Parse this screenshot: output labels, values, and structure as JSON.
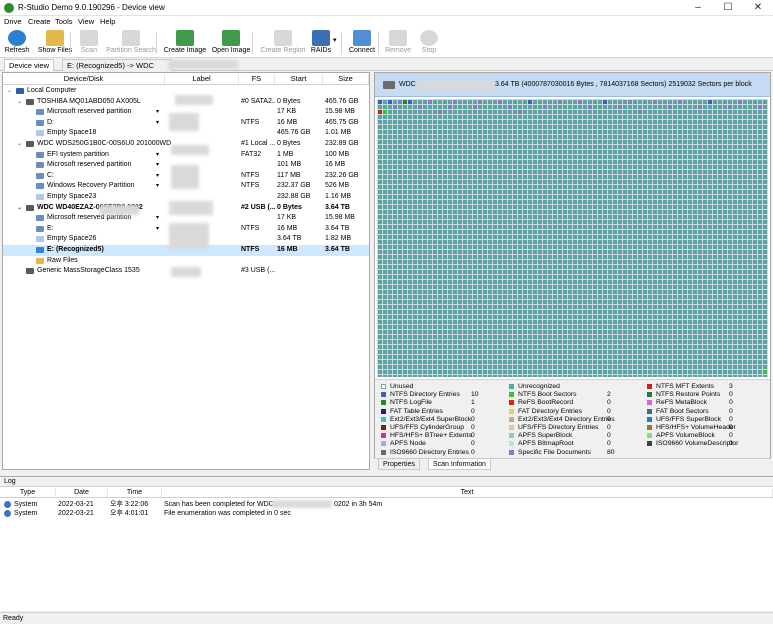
{
  "window": {
    "title": "R-Studio Demo 9.0.190296 - Device view",
    "minimize": "–",
    "maximize": "☐",
    "close": "✕"
  },
  "menu": [
    "Drive",
    "Create",
    "Tools",
    "View",
    "Help"
  ],
  "toolbar": [
    {
      "label": "Refresh",
      "enabled": true,
      "color": "#2d7fd1",
      "icon": "refresh-icon"
    },
    {
      "label": "Show Files",
      "enabled": true,
      "color": "#e4b84a",
      "icon": "show-files-icon"
    },
    {
      "label": "Scan",
      "enabled": false,
      "color": "#d8d8d8",
      "icon": "scan-icon"
    },
    {
      "label": "Partition Search",
      "enabled": false,
      "color": "#d8d8d8",
      "icon": "partition-search-icon"
    },
    {
      "label": "Create Image",
      "enabled": true,
      "color": "#3f9a4a",
      "icon": "create-image-icon"
    },
    {
      "label": "Open Image",
      "enabled": true,
      "color": "#3f9a4a",
      "icon": "open-image-icon"
    },
    {
      "label": "Create Region",
      "enabled": false,
      "color": "#d8d8d8",
      "icon": "create-region-icon"
    },
    {
      "label": "RAIDs",
      "enabled": true,
      "color": "#3c6fb5",
      "icon": "raids-icon"
    },
    {
      "label": "Connect",
      "enabled": true,
      "color": "#4f8fd6",
      "icon": "connect-icon"
    },
    {
      "label": "Remove",
      "enabled": false,
      "color": "#d8d8d8",
      "icon": "remove-icon"
    },
    {
      "label": "Stop",
      "enabled": false,
      "color": "#d8d8d8",
      "icon": "stop-icon"
    }
  ],
  "tabs": {
    "device_view": "Device view",
    "current": "E: (Recognized5) -> WDC WD"
  },
  "tree": {
    "headers": {
      "device": "Device/Disk",
      "label": "Label",
      "fs": "FS",
      "start": "Start",
      "size": "Size"
    },
    "rows": [
      {
        "name": "Local Computer",
        "fs": "",
        "start": "",
        "size": "",
        "dd": false,
        "bold": false,
        "sel": false
      },
      {
        "name": "TOSHIBA MQ01ABD050 AX005L",
        "fs": "#0 SATA2...",
        "start": "0 Bytes",
        "size": "465.76 GB",
        "dd": false,
        "bold": false,
        "sel": false
      },
      {
        "name": "Microsoft reserved partition",
        "fs": "",
        "start": "17 KB",
        "size": "15.98 MB",
        "dd": true,
        "bold": false,
        "sel": false
      },
      {
        "name": "D:",
        "fs": "NTFS",
        "start": "16 MB",
        "size": "465.75 GB",
        "dd": true,
        "bold": false,
        "sel": false
      },
      {
        "name": "Empty Space18",
        "fs": "",
        "start": "465.76 GB",
        "size": "1.01 MB",
        "dd": false,
        "bold": false,
        "sel": false
      },
      {
        "name": "WDC WDS250G1B0C-00S6U0 201000WD",
        "fs": "#1 Local ...",
        "start": "0 Bytes",
        "size": "232.89 GB",
        "dd": false,
        "bold": false,
        "sel": false
      },
      {
        "name": "EFI system partition",
        "fs": "FAT32",
        "start": "1 MB",
        "size": "100 MB",
        "dd": true,
        "bold": false,
        "sel": false
      },
      {
        "name": "Microsoft reserved partition",
        "fs": "",
        "start": "101 MB",
        "size": "16 MB",
        "dd": true,
        "bold": false,
        "sel": false
      },
      {
        "name": "C:",
        "fs": "NTFS",
        "start": "117 MB",
        "size": "232.26 GB",
        "dd": true,
        "bold": false,
        "sel": false
      },
      {
        "name": "Windows Recovery Partition",
        "fs": "NTFS",
        "start": "232.37 GB",
        "size": "526 MB",
        "dd": true,
        "bold": false,
        "sel": false
      },
      {
        "name": "Empty Space23",
        "fs": "",
        "start": "232.88 GB",
        "size": "1.16 MB",
        "dd": false,
        "bold": false,
        "sel": false
      },
      {
        "name": "WDC WD40EZAZ-00SF3B0 0202",
        "fs": "#2 USB (...",
        "start": "0 Bytes",
        "size": "3.64 TB",
        "dd": false,
        "bold": true,
        "sel": false
      },
      {
        "name": "Microsoft reserved partition",
        "fs": "",
        "start": "17 KB",
        "size": "15.98 MB",
        "dd": true,
        "bold": false,
        "sel": false
      },
      {
        "name": "E:",
        "fs": "NTFS",
        "start": "16 MB",
        "size": "3.64 TB",
        "dd": true,
        "bold": false,
        "sel": false
      },
      {
        "name": "Empty Space26",
        "fs": "",
        "start": "3.64 TB",
        "size": "1.82 MB",
        "dd": false,
        "bold": false,
        "sel": false
      },
      {
        "name": "E: (Recognized5)",
        "fs": "NTFS",
        "start": "16 MB",
        "size": "3.64 TB",
        "dd": false,
        "bold": true,
        "sel": true
      },
      {
        "name": "Raw Files",
        "fs": "",
        "start": "",
        "size": "",
        "dd": false,
        "bold": false,
        "sel": false
      },
      {
        "name": "Generic MassStorageClass 1535",
        "fs": "#3 USB (...",
        "start": "",
        "size": "",
        "dd": false,
        "bold": false,
        "sel": false
      }
    ]
  },
  "scan": {
    "disk_name": "WDC",
    "info": "3.64 TB (4000787030016 Bytes , 7814037168 Sectors) 2519032 Sectors per block",
    "legend": [
      {
        "label": "Unused",
        "count": "",
        "color": "#ffffff"
      },
      {
        "label": "NTFS Directory Entries",
        "count": "10",
        "color": "#3a5fcd"
      },
      {
        "label": "NTFS LogFile",
        "count": "1",
        "color": "#1e8c1e"
      },
      {
        "label": "FAT Table Entries",
        "count": "0",
        "color": "#1c1c9c"
      },
      {
        "label": "Ext2/Ext3/Ext4 SuperBlock",
        "count": "0",
        "color": "#2cc7c7"
      },
      {
        "label": "UFS/FFS CylinderGroup",
        "count": "0",
        "color": "#7a1f1f"
      },
      {
        "label": "HFS/HFS+ BTree+ Extents",
        "count": "0",
        "color": "#c42fc4"
      },
      {
        "label": "APFS Node",
        "count": "0",
        "color": "#c0a0e0"
      },
      {
        "label": "ISO9660 Directory Entries",
        "count": "0",
        "color": "#6a6a6a"
      },
      {
        "label": "Unrecognized",
        "count": "",
        "color": "#5ea3a3"
      },
      {
        "label": "NTFS Boot Sectors",
        "count": "2",
        "color": "#2fc72f"
      },
      {
        "label": "ReFS BootRecord",
        "count": "0",
        "color": "#e02020"
      },
      {
        "label": "FAT Directory Entries",
        "count": "0",
        "color": "#f0d040"
      },
      {
        "label": "Ext2/Ext3/Ext4 Directory Entries",
        "count": "0",
        "color": "#c8b070"
      },
      {
        "label": "UFS/FFS Directory Entries",
        "count": "0",
        "color": "#e0c0c0"
      },
      {
        "label": "APFS SuperBlock",
        "count": "0",
        "color": "#7fd7a0"
      },
      {
        "label": "APFS BItmapRoot",
        "count": "0",
        "color": "#b8e0e0"
      },
      {
        "label": "Specific File Documents",
        "count": "80",
        "color": "#8a78c8"
      },
      {
        "label": "NTFS MFT Extents",
        "count": "3",
        "color": "#d02020"
      },
      {
        "label": "NTFS Restore Points",
        "count": "0",
        "color": "#1f7a4a"
      },
      {
        "label": "ReFS MetaBlock",
        "count": "0",
        "color": "#e060e0"
      },
      {
        "label": "FAT Boot Sectors",
        "count": "0",
        "color": "#2a7a7a"
      },
      {
        "label": "UFS/FFS SuperBlock",
        "count": "0",
        "color": "#2080c0"
      },
      {
        "label": "HFS/HFS+ VolumeHeader",
        "count": "0",
        "color": "#9a7a20"
      },
      {
        "label": "APFS VolumeBlock",
        "count": "0",
        "color": "#80e080"
      },
      {
        "label": "ISO9660 VolumeDescriptor",
        "count": "0",
        "color": "#404040"
      }
    ],
    "tabs": {
      "properties": "Properties",
      "scan_info": "Scan Information"
    }
  },
  "log": {
    "title": "Log",
    "headers": {
      "type": "Type",
      "date": "Date",
      "time": "Time",
      "text": "Text"
    },
    "rows": [
      {
        "type": "System",
        "date": "2022-03-21",
        "time": "오후 3:22:06",
        "text": "Scan has been completed for WDC",
        "text_end": "0202 in 3h 54m"
      },
      {
        "type": "System",
        "date": "2022-03-21",
        "time": "오후 4:01:01",
        "text": "File enumeration was completed in 0 sec",
        "text_end": ""
      }
    ]
  },
  "status": "Ready"
}
